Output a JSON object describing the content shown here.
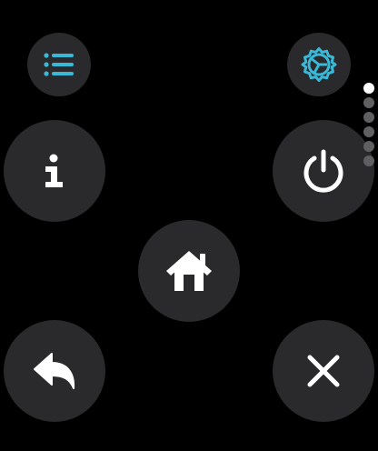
{
  "colors": {
    "background": "#000000",
    "button": "#2a2a2c",
    "accent": "#3ab8d8",
    "icon": "#ffffff",
    "dot_inactive": "#5f5f61",
    "dot_active": "#ffffff"
  },
  "buttons": {
    "list": {
      "icon": "list-icon"
    },
    "settings": {
      "icon": "gear-icon"
    },
    "info": {
      "icon": "info-icon"
    },
    "power": {
      "icon": "power-icon"
    },
    "home": {
      "icon": "home-icon"
    },
    "back": {
      "icon": "reply-icon"
    },
    "close": {
      "icon": "close-icon"
    }
  },
  "page_indicator": {
    "pages": 6,
    "current": 1
  }
}
